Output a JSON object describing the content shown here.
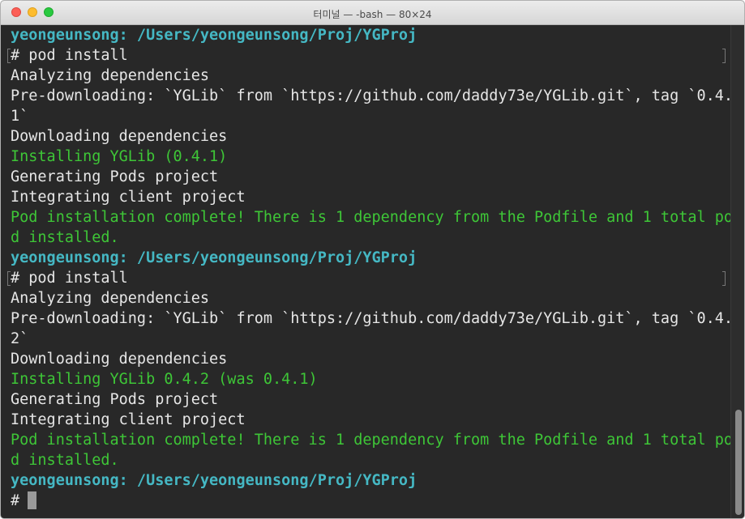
{
  "window": {
    "title": "터미널 — -bash — 80×24"
  },
  "terminal": {
    "lines": [
      {
        "text": "yeongeunsong: /Users/yeongeunsong/Proj/YGProj",
        "style": "prompt"
      },
      {
        "text": "# pod install",
        "style": "cmd"
      },
      {
        "text": "Analyzing dependencies",
        "style": "normal"
      },
      {
        "text": "Pre-downloading: `YGLib` from `https://github.com/daddy73e/YGLib.git`, tag `0.4.",
        "style": "normal"
      },
      {
        "text": "1`",
        "style": "normal"
      },
      {
        "text": "Downloading dependencies",
        "style": "normal"
      },
      {
        "text": "Installing YGLib (0.4.1)",
        "style": "green"
      },
      {
        "text": "Generating Pods project",
        "style": "normal"
      },
      {
        "text": "Integrating client project",
        "style": "normal"
      },
      {
        "text": "Pod installation complete! There is 1 dependency from the Podfile and 1 total po",
        "style": "green"
      },
      {
        "text": "d installed.",
        "style": "green"
      },
      {
        "text": "yeongeunsong: /Users/yeongeunsong/Proj/YGProj",
        "style": "prompt"
      },
      {
        "text": "# pod install",
        "style": "cmd"
      },
      {
        "text": "Analyzing dependencies",
        "style": "normal"
      },
      {
        "text": "Pre-downloading: `YGLib` from `https://github.com/daddy73e/YGLib.git`, tag `0.4.",
        "style": "normal"
      },
      {
        "text": "2`",
        "style": "normal"
      },
      {
        "text": "Downloading dependencies",
        "style": "normal"
      },
      {
        "text": "Installing YGLib 0.4.2 (was 0.4.1)",
        "style": "green"
      },
      {
        "text": "Generating Pods project",
        "style": "normal"
      },
      {
        "text": "Integrating client project",
        "style": "normal"
      },
      {
        "text": "Pod installation complete! There is 1 dependency from the Podfile and 1 total po",
        "style": "green"
      },
      {
        "text": "d installed.",
        "style": "green"
      },
      {
        "text": "yeongeunsong: /Users/yeongeunsong/Proj/YGProj",
        "style": "prompt"
      }
    ],
    "current_prompt": "#"
  },
  "colors": {
    "background": "#282828",
    "text": "#e6e6e6",
    "green": "#3ec637",
    "prompt": "#45b8c4"
  }
}
